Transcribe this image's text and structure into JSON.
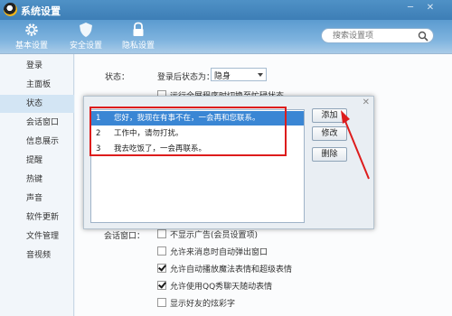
{
  "window": {
    "title": "系统设置"
  },
  "toolbar": {
    "tabs": [
      {
        "label": "基本设置",
        "icon": "gear-icon"
      },
      {
        "label": "安全设置",
        "icon": "shield-icon"
      },
      {
        "label": "隐私设置",
        "icon": "lock-icon"
      }
    ],
    "search_placeholder": "搜索设置项"
  },
  "sidebar": {
    "items": [
      "登录",
      "主面板",
      "状态",
      "会话窗口",
      "信息展示",
      "提醒",
      "热键",
      "声音",
      "软件更新",
      "文件管理",
      "音视频"
    ],
    "active_index": 2
  },
  "status": {
    "section_label": "状态：",
    "after_login_label": "登录后状态为：",
    "after_login_value": "隐身",
    "behind_dialog_text": "运行全屏程序时切换至忙碌状态"
  },
  "dialog": {
    "messages": [
      {
        "num": "1",
        "text": "您好，我现在有事不在，一会再和您联系。"
      },
      {
        "num": "2",
        "text": "工作中，请勿打扰。"
      },
      {
        "num": "3",
        "text": "我去吃饭了，一会再联系。"
      }
    ],
    "selected_index": 0,
    "buttons": {
      "add": "添加",
      "edit": "修改",
      "delete": "删除"
    },
    "accent_color": "#dd1c1c"
  },
  "session": {
    "section_label": "会话窗口：",
    "options": [
      {
        "label": "不显示广告(会员设置项)",
        "checked": false
      },
      {
        "label": "允许来消息时自动弹出窗口",
        "checked": false
      },
      {
        "label": "允许自动播放魔法表情和超级表情",
        "checked": true
      },
      {
        "label": "允许使用QQ秀聊天随动表情",
        "checked": true
      },
      {
        "label": "显示好友的炫彩字",
        "checked": false
      }
    ]
  },
  "colors": {
    "titlebar": "#3d7eb6",
    "selection": "#3a86d4",
    "highlight": "#dd1c1c"
  }
}
